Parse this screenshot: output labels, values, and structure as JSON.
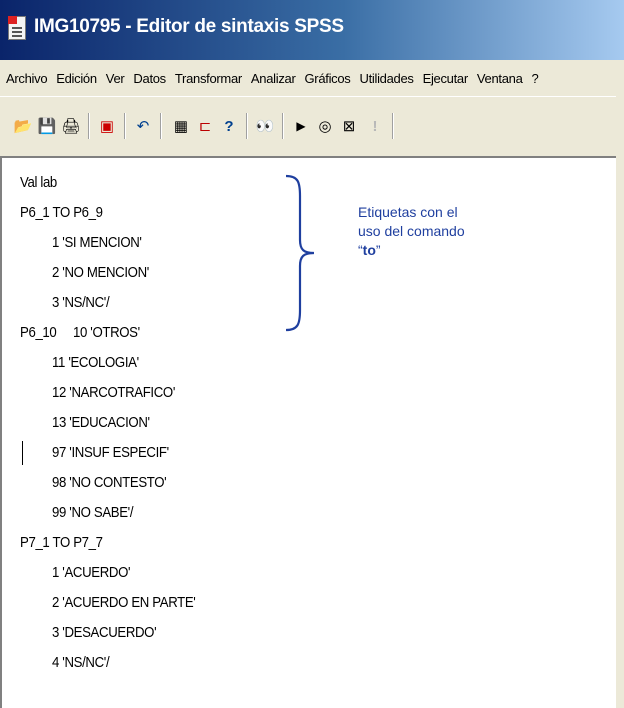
{
  "window": {
    "title": "IMG10795 - Editor de sintaxis SPSS",
    "app_icon": "spss-document-icon"
  },
  "menu": [
    {
      "label": "Archivo"
    },
    {
      "label": "Edición"
    },
    {
      "label": "Ver"
    },
    {
      "label": "Datos"
    },
    {
      "label": "Transformar"
    },
    {
      "label": "Analizar"
    },
    {
      "label": "Gráficos"
    },
    {
      "label": "Utilidades"
    },
    {
      "label": "Ejecutar"
    },
    {
      "label": "Ventana"
    },
    {
      "label": "?"
    }
  ],
  "toolbar": {
    "buttons": [
      {
        "icon": "open-folder-icon",
        "glyph": "📂"
      },
      {
        "icon": "save-icon",
        "glyph": "💾"
      },
      {
        "icon": "print-icon",
        "glyph": "🖨"
      },
      {
        "icon": "dialog-recall-icon",
        "glyph": "▣"
      },
      {
        "icon": "undo-icon",
        "glyph": "↶"
      },
      {
        "icon": "goto-case-icon",
        "glyph": "▦"
      },
      {
        "icon": "variables-icon",
        "glyph": "⊏"
      },
      {
        "icon": "variable-info-icon",
        "glyph": "?"
      },
      {
        "icon": "find-icon",
        "glyph": "👀"
      },
      {
        "icon": "run-icon",
        "glyph": "▶"
      },
      {
        "icon": "use-sets-icon",
        "glyph": "◎"
      },
      {
        "icon": "syntax-help-icon",
        "glyph": "⊠"
      },
      {
        "icon": "disabled-exclaim-icon",
        "glyph": "!"
      }
    ]
  },
  "editor": {
    "lines": [
      {
        "text": "Val lab"
      },
      {
        "text": "P6_1 TO P6_9"
      },
      {
        "text": "1 'SI MENCION'"
      },
      {
        "text": "2 'NO MENCION'"
      },
      {
        "text": "3 'NS/NC'/"
      },
      {
        "text": "P6_10     10 'OTROS'"
      },
      {
        "text": "11 'ECOLOGIA'"
      },
      {
        "text": "12 'NARCOTRAFICO'"
      },
      {
        "text": "13 'EDUCACION'"
      },
      {
        "text": "97 'INSUF ESPECIF'"
      },
      {
        "text": "98 'NO CONTESTO'"
      },
      {
        "text": "99 'NO SABE'/"
      },
      {
        "text": "P7_1 TO P7_7"
      },
      {
        "text": "1 'ACUERDO'"
      },
      {
        "text": "2 'ACUERDO EN PARTE'"
      },
      {
        "text": "3 'DESACUERDO'"
      },
      {
        "text": "4 'NS/NC'/"
      }
    ]
  },
  "annotation": {
    "line1": "Etiquetas con el",
    "line2": "uso del comando",
    "quote_open": "“",
    "keyword": "to",
    "quote_close": "”",
    "color": "#1f3f9f"
  }
}
